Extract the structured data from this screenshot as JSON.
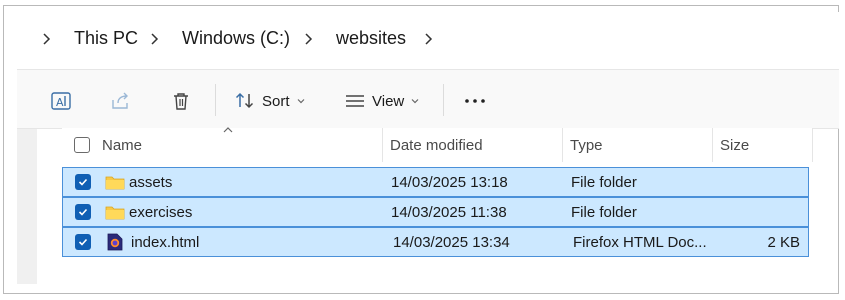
{
  "breadcrumb": {
    "items": [
      "This PC",
      "Windows (C:)",
      "websites"
    ]
  },
  "toolbar": {
    "sort_label": "Sort",
    "view_label": "View",
    "icons": [
      "rename-icon",
      "share-icon",
      "delete-icon",
      "sort-icon",
      "view-icon",
      "more-icon"
    ]
  },
  "columns": {
    "name": "Name",
    "date": "Date modified",
    "type": "Type",
    "size": "Size"
  },
  "rows": [
    {
      "name": "assets",
      "date": "14/03/2025 13:18",
      "type": "File folder",
      "size": "",
      "icon": "folder-icon",
      "selected": true
    },
    {
      "name": "exercises",
      "date": "14/03/2025 11:38",
      "type": "File folder",
      "size": "",
      "icon": "folder-icon",
      "selected": true
    },
    {
      "name": "index.html",
      "date": "14/03/2025 13:34",
      "type": "Firefox HTML Doc...",
      "size": "2 KB",
      "icon": "html-file-icon",
      "selected": true
    }
  ],
  "colors": {
    "selection_bg": "#cce8ff",
    "selection_border": "#4a90d9",
    "checkbox": "#0f5fb4",
    "folder": "#f7c948"
  }
}
